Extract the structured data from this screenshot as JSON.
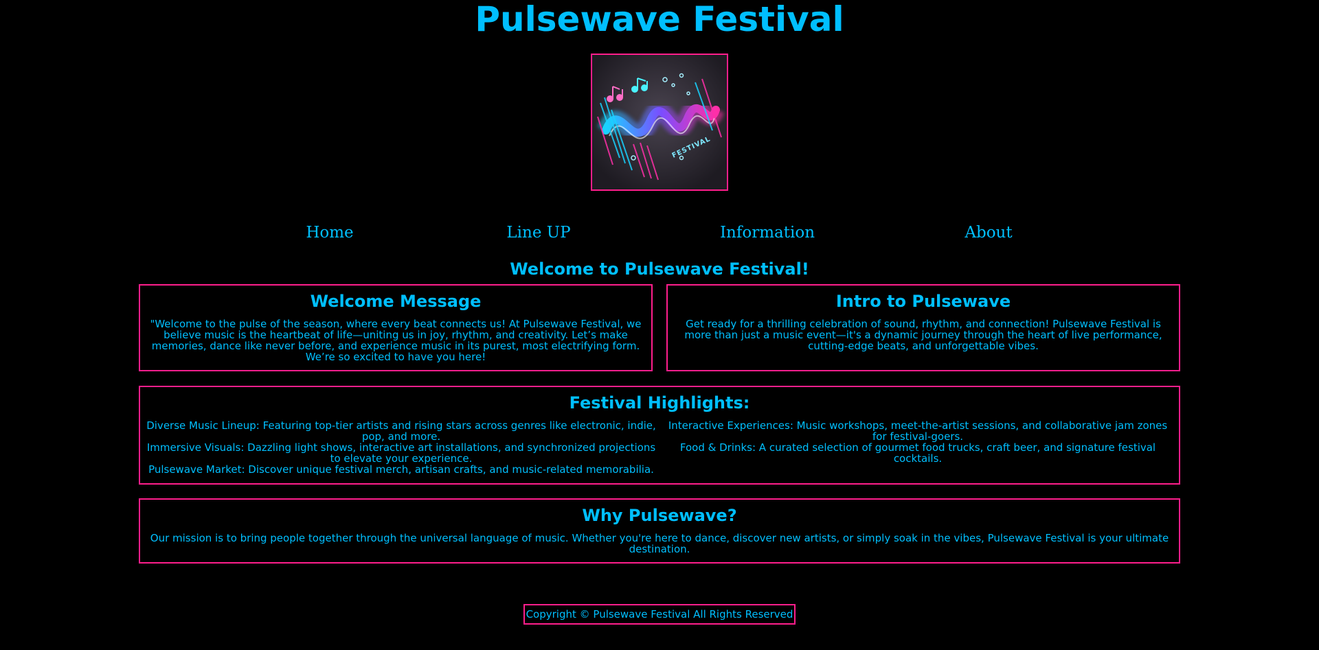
{
  "header": {
    "title": "Pulsewave Festival",
    "logo_text": "FESTIVAL"
  },
  "nav": {
    "items": [
      {
        "label": "Home"
      },
      {
        "label": "Line UP"
      },
      {
        "label": "Information"
      },
      {
        "label": "About"
      }
    ]
  },
  "main": {
    "heading": "Welcome to Pulsewave Festival!",
    "welcome": {
      "title": "Welcome Message",
      "text": "\"Welcome to the pulse of the season, where every beat connects us! At Pulsewave Festival, we believe music is the heartbeat of life—uniting us in joy, rhythm, and creativity. Let’s make memories, dance like never before, and experience music in its purest, most electrifying form. We’re so excited to have you here!"
    },
    "intro": {
      "title": "Intro to Pulsewave",
      "text": "Get ready for a thrilling celebration of sound, rhythm, and connection! Pulsewave Festival is more than just a music event—it's a dynamic journey through the heart of live performance, cutting-edge beats, and unforgettable vibes."
    },
    "highlights": {
      "title": "Festival Highlights:",
      "items": [
        "Diverse Music Lineup: Featuring top-tier artists and rising stars across genres like electronic, indie, pop, and more.",
        "Interactive Experiences: Music workshops, meet-the-artist sessions, and collaborative jam zones for festival-goers.",
        "Immersive Visuals: Dazzling light shows, interactive art installations, and synchronized projections to elevate your experience.",
        "Food & Drinks: A curated selection of gourmet food trucks, craft beer, and signature festival cocktails.",
        "Pulsewave Market: Discover unique festival merch, artisan crafts, and music-related memorabilia."
      ]
    },
    "why": {
      "title": "Why Pulsewave?",
      "text": "Our mission is to bring people together through the universal language of music. Whether you're here to dance, discover new artists, or simply soak in the vibes, Pulsewave Festival is your ultimate destination."
    }
  },
  "footer": {
    "text": "Copyright © Pulsewave Festival All Rights Reserved"
  },
  "colors": {
    "background": "#000000",
    "text": "#00bfff",
    "border": "#ff1e8c"
  }
}
